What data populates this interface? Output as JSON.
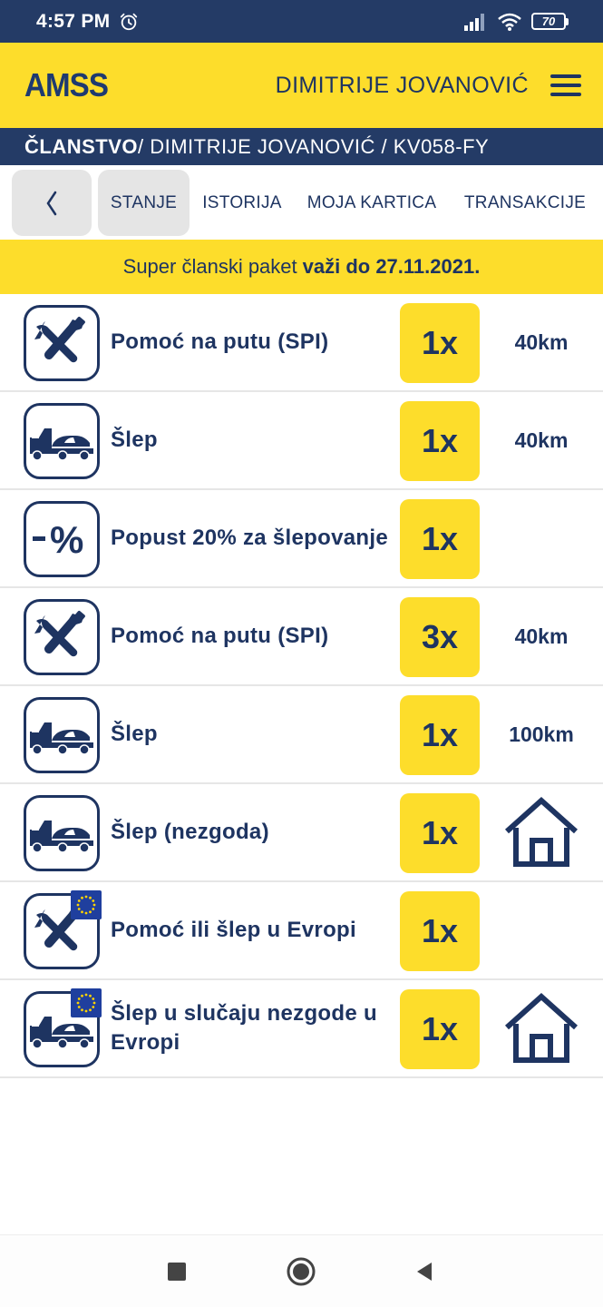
{
  "status_bar": {
    "time": "4:57 PM",
    "battery": "70",
    "icons": [
      "alarm-icon",
      "signal-icon",
      "wifi-icon",
      "battery-icon"
    ]
  },
  "header": {
    "logo": "AMSS",
    "user_name": "DIMITRIJE JOVANOVIĆ",
    "menu_icon": "hamburger-menu-icon",
    "brand_color": "#fddd2b",
    "navy_color": "#243b66"
  },
  "breadcrumb": {
    "section": "ČLANSTVO",
    "path": " / DIMITRIJE JOVANOVIĆ / KV058-FY"
  },
  "tabs": {
    "back_icon": "chevron-left-icon",
    "items": [
      {
        "label": "STANJE",
        "active": true
      },
      {
        "label": "ISTORIJA",
        "active": false
      },
      {
        "label": "MOJA KARTICA",
        "active": false
      },
      {
        "label": "TRANSAKCIJE",
        "active": false
      }
    ]
  },
  "banner": {
    "text": "Super članski paket",
    "valid_until": "važi do 27.11.2021."
  },
  "services": [
    {
      "icon": "tools-icon",
      "eu": false,
      "label": "Pomoć na putu (SPI)",
      "qty": "1x",
      "distance": "40km",
      "home": false
    },
    {
      "icon": "tow-truck-icon",
      "eu": false,
      "label": "Šlep",
      "qty": "1x",
      "distance": "40km",
      "home": false
    },
    {
      "icon": "discount-icon",
      "eu": false,
      "label": "Popust 20% za šlepovanje",
      "qty": "1x",
      "distance": "",
      "home": false
    },
    {
      "icon": "tools-icon",
      "eu": false,
      "label": "Pomoć na putu (SPI)",
      "qty": "3x",
      "distance": "40km",
      "home": false
    },
    {
      "icon": "tow-truck-icon",
      "eu": false,
      "label": "Šlep",
      "qty": "1x",
      "distance": "100km",
      "home": false
    },
    {
      "icon": "tow-truck-icon",
      "eu": false,
      "label": "Šlep (nezgoda)",
      "qty": "1x",
      "distance": "",
      "home": true
    },
    {
      "icon": "tools-icon",
      "eu": true,
      "label": "Pomoć ili šlep u Evropi",
      "qty": "1x",
      "distance": "",
      "home": false
    },
    {
      "icon": "tow-truck-icon",
      "eu": true,
      "label": "Šlep u slučaju nezgode u Evropi",
      "qty": "1x",
      "distance": "",
      "home": true
    }
  ],
  "nav_bar": {
    "icons": [
      "recents-square-icon",
      "home-circle-icon",
      "back-triangle-icon"
    ]
  }
}
